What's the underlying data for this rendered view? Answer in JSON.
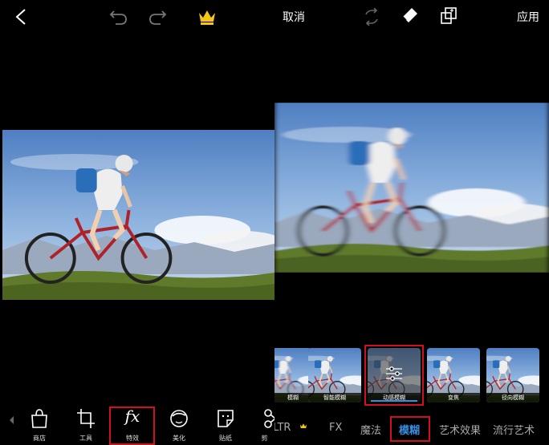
{
  "left_editor": {
    "top_bar": {
      "back_icon": "chevron-left-icon",
      "undo_icon": "undo-icon",
      "redo_icon": "redo-icon",
      "premium_icon": "crown-icon"
    },
    "toolbar": {
      "items": [
        {
          "label": "商店",
          "icon": "shopping-bag-icon"
        },
        {
          "label": "工具",
          "icon": "crop-icon"
        },
        {
          "label": "特效",
          "icon": "fx-icon",
          "icon_text": "fx",
          "highlighted": true
        },
        {
          "label": "美化",
          "icon": "face-icon"
        },
        {
          "label": "贴纸",
          "icon": "sticker-icon"
        },
        {
          "label": "剪",
          "icon": "scissors-icon"
        }
      ]
    }
  },
  "right_editor": {
    "top_bar": {
      "next_icon": "arrow-right-circle-icon",
      "cancel_label": "取消",
      "refresh_icon": "refresh-icon",
      "eraser_icon": "eraser-icon",
      "layers_icon": "layers-icon",
      "apply_label": "应用"
    },
    "effect_thumbnails": [
      {
        "label": "模糊"
      },
      {
        "label": "智能模糊"
      },
      {
        "label": "动感模糊",
        "selected": true,
        "settings_icon": "sliders-icon"
      },
      {
        "label": "变焦"
      },
      {
        "label": "径向模糊"
      }
    ],
    "categories": [
      {
        "label": "LTR",
        "premium": true
      },
      {
        "label": "FX"
      },
      {
        "label": "魔法"
      },
      {
        "label": "模糊",
        "active": true
      },
      {
        "label": "艺术效果"
      },
      {
        "label": "流行艺术"
      }
    ],
    "colors": {
      "active_category": "#3a8dde",
      "highlight_box": "#d0101a",
      "crown": "#f5c518"
    }
  }
}
